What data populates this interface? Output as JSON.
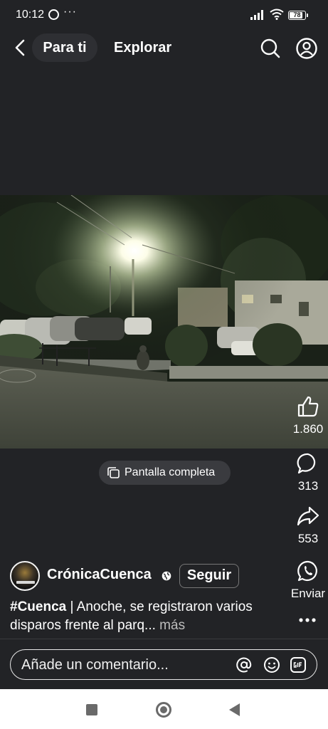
{
  "status_bar": {
    "time": "10:12",
    "notification_icons": [
      "whatsapp-icon",
      "more-dots"
    ],
    "more": "···",
    "battery": "78",
    "battery_level": 0.78
  },
  "nav": {
    "tabs": [
      {
        "label": "Para ti",
        "active": true
      },
      {
        "label": "Explorar",
        "active": false
      }
    ]
  },
  "video": {
    "fullscreen_label": "Pantalla completa"
  },
  "actions": {
    "likes": "1.860",
    "comments": "313",
    "shares": "553",
    "send_label": "Enviar"
  },
  "post": {
    "author": "CrónicaCuenca",
    "follow_label": "Seguir",
    "hashtag": "#Cuenca",
    "caption": " | Anoche, se registraron varios disparos frente al parq...",
    "more_label": " más"
  },
  "comment_box": {
    "placeholder": "Añade un comentario..."
  },
  "colors": {
    "background": "#222326",
    "text": "#ffffff",
    "pill": "#3a3b3f",
    "navbar": "#ffffff",
    "navbar_icons": "#6a6a6a"
  }
}
